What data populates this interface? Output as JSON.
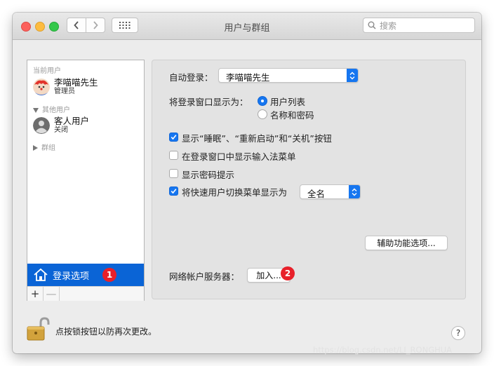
{
  "window": {
    "title": "用户与群组"
  },
  "search": {
    "placeholder": "搜索"
  },
  "sidebar": {
    "current_header": "当前用户",
    "current_user": {
      "name": "李喵喵先生",
      "role": "管理员"
    },
    "other_header": "其他用户",
    "guest_user": {
      "name": "客人用户",
      "role": "关闭"
    },
    "groups_header": "群组",
    "login_options": "登录选项",
    "add_symbol": "+",
    "remove_symbol": "—"
  },
  "main": {
    "auto_login_label": "自动登录：",
    "auto_login_value": "李喵喵先生",
    "display_as_label": "将登录窗口显示为：",
    "radio_user_list": "用户列表",
    "radio_name_password": "名称和密码",
    "check_sleep_restart": "显示“睡眠”、“重新启动”和“关机”按钮",
    "check_input_menu": "在登录窗口中显示输入法菜单",
    "check_password_hints": "显示密码提示",
    "check_fast_switch": "将快速用户切换菜单显示为",
    "fast_switch_value": "全名",
    "accessibility_button": "辅助功能选项...",
    "network_server_label": "网络帐户服务器：",
    "join_button": "加入..."
  },
  "checks": {
    "sleep_restart": true,
    "input_menu": false,
    "password_hints": false,
    "fast_switch": true
  },
  "radio_selected": "user_list",
  "badges": {
    "one": "1",
    "two": "2"
  },
  "footer": {
    "lock_text": "点按锁按钮以防再次更改。",
    "help_symbol": "?"
  },
  "watermark": "https://blog.csdn.net/LI_RONGHUA",
  "colors": {
    "accent": "#1676f0",
    "selection": "#0a64d6",
    "badge": "#e8202a"
  }
}
